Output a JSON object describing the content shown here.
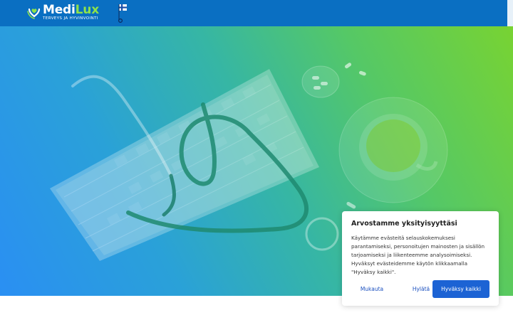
{
  "header": {
    "logo": {
      "name_part1": "Medi",
      "name_part2": "Lux",
      "tagline": "TERVEYS JA HYVINVOINTI"
    },
    "language_flag": "finland-flag-icon"
  },
  "hero": {
    "image": "keyboard-stethoscope-tea-pills-photo"
  },
  "cookie_banner": {
    "title": "Arvostamme yksityisyyttäsi",
    "body": "Käytämme evästeitä selauskokemuksesi parantamiseksi, personoitujen mainosten ja sisällön tarjoamiseksi ja liikenteemme analysoimiseksi. Hyväksyt evästeidemme käytön klikkaamalla \"Hyväksy kaikki\".",
    "customize_label": "Mukauta",
    "reject_label": "Hylätä",
    "accept_label": "Hyväksy kaikki"
  },
  "colors": {
    "header_bg": "#0a6fc2",
    "logo_accent": "#8ee24a",
    "accept_button": "#1c63d4",
    "link_text": "#1a4fbf"
  }
}
